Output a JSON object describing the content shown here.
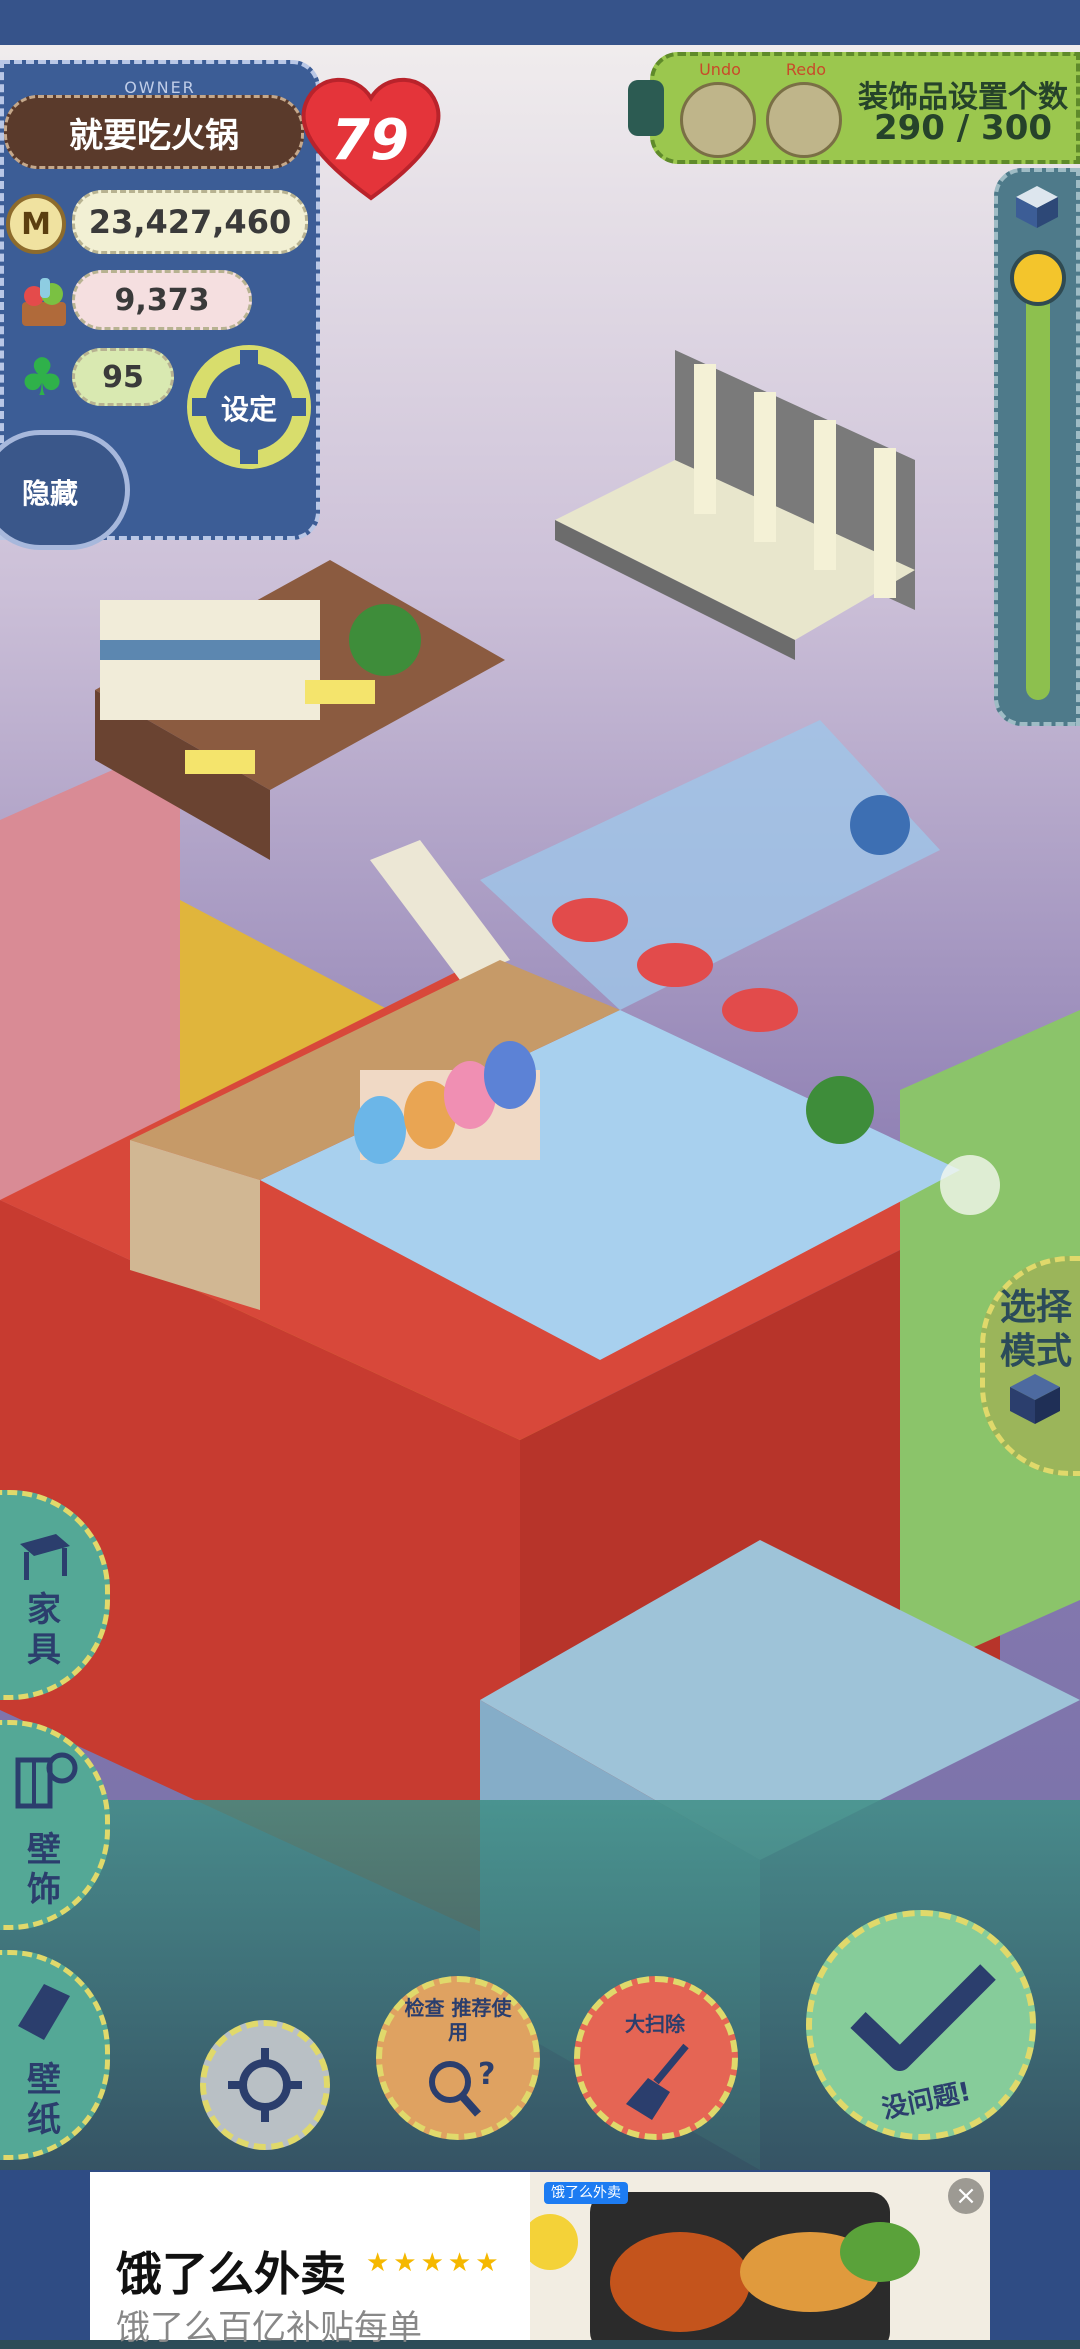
{
  "owner": {
    "label": "OWNER",
    "name": "就要吃火锅",
    "level": "79"
  },
  "resources": {
    "coins": "23,427,460",
    "coin_symbol": "M",
    "food": "9,373",
    "clover": "95"
  },
  "buttons": {
    "settings": "设定",
    "hide": "隐藏",
    "undo": "Undo",
    "redo": "Redo",
    "select_mode": "选择模式",
    "furniture": "家具",
    "wall_decor": "壁饰",
    "wallpaper": "壁纸",
    "help": "检查 推荐使用",
    "cleanup": "大扫除",
    "confirm": "没问题!"
  },
  "decoration": {
    "title": "装饰品设置个数",
    "count": "290 / 300"
  },
  "ad": {
    "badge": "饿了么外卖",
    "title": "饿了么外卖",
    "stars": "★★★★★",
    "subtitle": "饿了么百亿补贴每单",
    "close": "×"
  },
  "colors": {
    "denim": "#3c5d96",
    "green_panel": "#9bc74e",
    "heart": "#e4343a",
    "confirm": "#86cc9a"
  }
}
